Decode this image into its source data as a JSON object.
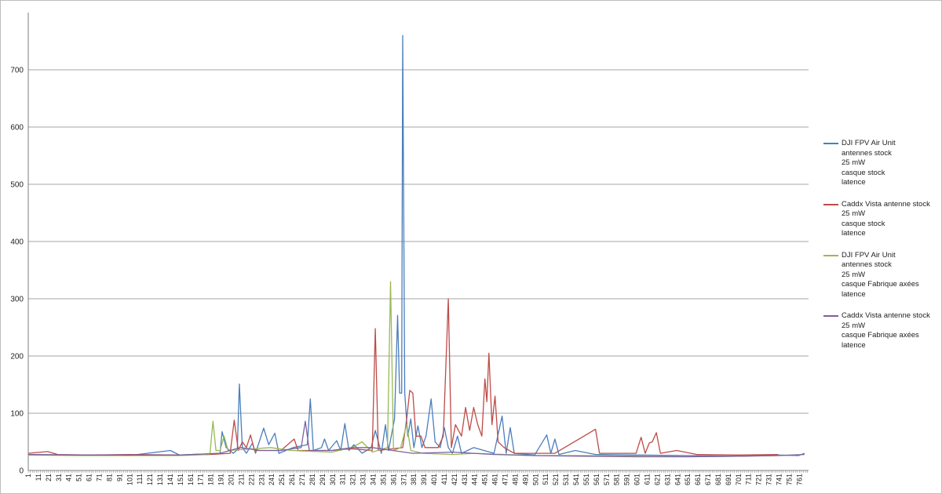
{
  "chart_data": {
    "type": "line",
    "title": "",
    "xlabel": "",
    "ylabel": "",
    "ylim": [
      0,
      800
    ],
    "xlim": [
      1,
      770
    ],
    "y_ticks": [
      "0",
      "100",
      "200",
      "300",
      "400",
      "500",
      "600",
      "700"
    ],
    "x_ticks": [
      "1",
      "11",
      "21",
      "31",
      "41",
      "51",
      "61",
      "71",
      "81",
      "91",
      "101",
      "111",
      "121",
      "131",
      "141",
      "151",
      "161",
      "171",
      "181",
      "191",
      "201",
      "211",
      "221",
      "231",
      "241",
      "251",
      "261",
      "271",
      "281",
      "291",
      "301",
      "311",
      "321",
      "331",
      "341",
      "351",
      "361",
      "371",
      "381",
      "391",
      "401",
      "411",
      "421",
      "431",
      "441",
      "451",
      "461",
      "471",
      "481",
      "491",
      "501",
      "511",
      "521",
      "531",
      "541",
      "551",
      "561",
      "571",
      "581",
      "591",
      "601",
      "611",
      "621",
      "631",
      "641",
      "651",
      "661",
      "671",
      "681",
      "691",
      "701",
      "711",
      "721",
      "731",
      "741",
      "751",
      "761"
    ],
    "grid": "horizontal",
    "legend_position": "right",
    "series": [
      {
        "name": "DJI FPV Air Unit\nantennes stock\n25 mW\n casque stock\nlatence",
        "color": "#4a7ebb",
        "points": [
          [
            1,
            28
          ],
          [
            50,
            27
          ],
          [
            100,
            26
          ],
          [
            141,
            35
          ],
          [
            150,
            27
          ],
          [
            190,
            30
          ],
          [
            192,
            68
          ],
          [
            196,
            40
          ],
          [
            203,
            30
          ],
          [
            207,
            36
          ],
          [
            209,
            151
          ],
          [
            212,
            40
          ],
          [
            216,
            30
          ],
          [
            222,
            48
          ],
          [
            225,
            30
          ],
          [
            233,
            74
          ],
          [
            238,
            45
          ],
          [
            244,
            65
          ],
          [
            248,
            30
          ],
          [
            262,
            40
          ],
          [
            276,
            45
          ],
          [
            279,
            125
          ],
          [
            282,
            35
          ],
          [
            290,
            40
          ],
          [
            293,
            55
          ],
          [
            297,
            35
          ],
          [
            305,
            52
          ],
          [
            309,
            35
          ],
          [
            313,
            82
          ],
          [
            317,
            35
          ],
          [
            322,
            45
          ],
          [
            330,
            30
          ],
          [
            339,
            40
          ],
          [
            343,
            70
          ],
          [
            349,
            30
          ],
          [
            353,
            80
          ],
          [
            356,
            35
          ],
          [
            362,
            90
          ],
          [
            365,
            271
          ],
          [
            367,
            135
          ],
          [
            369,
            135
          ],
          [
            370,
            760
          ],
          [
            372,
            135
          ],
          [
            375,
            60
          ],
          [
            378,
            90
          ],
          [
            381,
            40
          ],
          [
            385,
            78
          ],
          [
            389,
            40
          ],
          [
            393,
            60
          ],
          [
            398,
            125
          ],
          [
            402,
            50
          ],
          [
            407,
            40
          ],
          [
            411,
            75
          ],
          [
            415,
            40
          ],
          [
            419,
            30
          ],
          [
            424,
            60
          ],
          [
            428,
            30
          ],
          [
            440,
            40
          ],
          [
            460,
            30
          ],
          [
            468,
            95
          ],
          [
            472,
            30
          ],
          [
            476,
            75
          ],
          [
            480,
            30
          ],
          [
            500,
            27
          ],
          [
            512,
            62
          ],
          [
            516,
            30
          ],
          [
            520,
            55
          ],
          [
            524,
            28
          ],
          [
            540,
            35
          ],
          [
            560,
            28
          ],
          [
            600,
            27
          ],
          [
            650,
            26
          ],
          [
            700,
            25
          ],
          [
            740,
            27
          ],
          [
            760,
            26
          ],
          [
            766,
            30
          ]
        ]
      },
      {
        "name": "Caddx Vista antenne stock\n25 mW\n casque stock\nlatence",
        "color": "#be4b48",
        "points": [
          [
            1,
            30
          ],
          [
            20,
            33
          ],
          [
            30,
            28
          ],
          [
            60,
            27
          ],
          [
            100,
            28
          ],
          [
            150,
            27
          ],
          [
            180,
            28
          ],
          [
            200,
            30
          ],
          [
            204,
            88
          ],
          [
            208,
            35
          ],
          [
            212,
            50
          ],
          [
            216,
            40
          ],
          [
            220,
            62
          ],
          [
            224,
            35
          ],
          [
            250,
            35
          ],
          [
            263,
            55
          ],
          [
            267,
            35
          ],
          [
            300,
            35
          ],
          [
            320,
            38
          ],
          [
            340,
            35
          ],
          [
            343,
            248
          ],
          [
            346,
            35
          ],
          [
            370,
            40
          ],
          [
            374,
            90
          ],
          [
            377,
            140
          ],
          [
            380,
            135
          ],
          [
            383,
            60
          ],
          [
            388,
            60
          ],
          [
            392,
            40
          ],
          [
            405,
            40
          ],
          [
            410,
            60
          ],
          [
            415,
            300
          ],
          [
            418,
            40
          ],
          [
            422,
            80
          ],
          [
            428,
            60
          ],
          [
            432,
            110
          ],
          [
            436,
            70
          ],
          [
            440,
            110
          ],
          [
            444,
            80
          ],
          [
            448,
            60
          ],
          [
            451,
            160
          ],
          [
            453,
            120
          ],
          [
            455,
            205
          ],
          [
            458,
            80
          ],
          [
            461,
            130
          ],
          [
            464,
            50
          ],
          [
            470,
            40
          ],
          [
            480,
            30
          ],
          [
            520,
            30
          ],
          [
            560,
            72
          ],
          [
            564,
            30
          ],
          [
            600,
            30
          ],
          [
            605,
            58
          ],
          [
            609,
            30
          ],
          [
            613,
            48
          ],
          [
            616,
            50
          ],
          [
            620,
            66
          ],
          [
            624,
            30
          ],
          [
            640,
            35
          ],
          [
            660,
            28
          ],
          [
            700,
            27
          ],
          [
            740,
            28
          ]
        ]
      },
      {
        "name": "DJI FPV Air Unit\nantennes stock\n25 mW\n casque Fabrique axées\nlatence",
        "color": "#98b954",
        "points": [
          [
            1,
            27
          ],
          [
            50,
            26
          ],
          [
            100,
            26
          ],
          [
            150,
            26
          ],
          [
            180,
            28
          ],
          [
            183,
            86
          ],
          [
            186,
            35
          ],
          [
            190,
            35
          ],
          [
            194,
            60
          ],
          [
            198,
            35
          ],
          [
            240,
            40
          ],
          [
            260,
            35
          ],
          [
            300,
            32
          ],
          [
            320,
            40
          ],
          [
            330,
            50
          ],
          [
            340,
            32
          ],
          [
            355,
            40
          ],
          [
            358,
            330
          ],
          [
            361,
            35
          ],
          [
            368,
            40
          ],
          [
            374,
            80
          ],
          [
            378,
            35
          ],
          [
            390,
            30
          ],
          [
            420,
            28
          ],
          [
            440,
            30
          ],
          [
            470,
            28
          ],
          [
            500,
            26
          ],
          [
            550,
            26
          ],
          [
            600,
            25
          ],
          [
            650,
            24
          ],
          [
            700,
            25
          ],
          [
            740,
            26
          ]
        ]
      },
      {
        "name": "Caddx Vista antenne stock\n25 mW\n casque Fabrique axées\nlatence",
        "color": "#7d60a0",
        "points": [
          [
            1,
            28
          ],
          [
            50,
            27
          ],
          [
            100,
            27
          ],
          [
            150,
            27
          ],
          [
            190,
            30
          ],
          [
            210,
            40
          ],
          [
            230,
            35
          ],
          [
            250,
            35
          ],
          [
            270,
            40
          ],
          [
            274,
            86
          ],
          [
            278,
            35
          ],
          [
            300,
            35
          ],
          [
            320,
            40
          ],
          [
            340,
            40
          ],
          [
            360,
            35
          ],
          [
            380,
            30
          ],
          [
            420,
            32
          ],
          [
            460,
            28
          ],
          [
            500,
            26
          ],
          [
            550,
            25
          ],
          [
            600,
            24
          ],
          [
            650,
            24
          ],
          [
            700,
            25
          ],
          [
            740,
            26
          ],
          [
            766,
            28
          ]
        ]
      }
    ]
  }
}
